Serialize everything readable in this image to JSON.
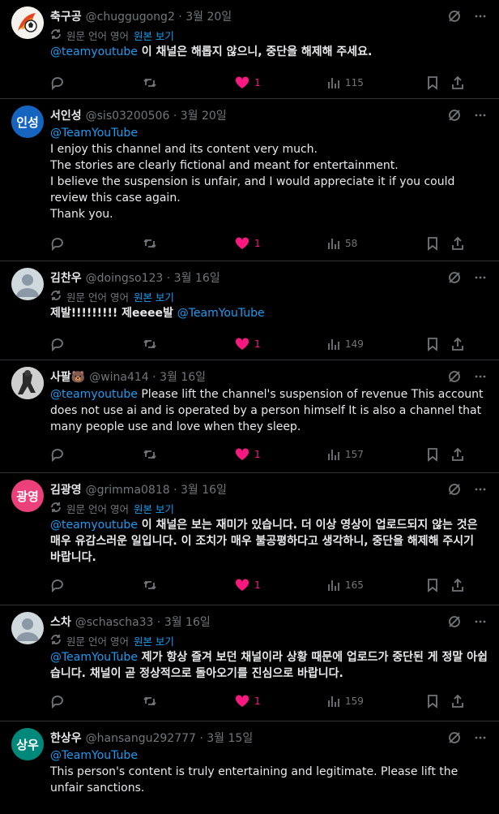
{
  "colors": {
    "accent": "#1d9bf0",
    "like": "#f91880",
    "muted": "#71767b"
  },
  "translate_label": "원문 언어 영어",
  "translate_link": "원본 보기",
  "tweets": [
    {
      "name": "축구공",
      "meta": "@chuggugong2 · 3월 20일",
      "mention": "@teamyoutube",
      "text": " 이 채널은 해롭지 않으니, 중단을 해제해 주세요.",
      "likes": "1",
      "views": "115"
    },
    {
      "name": "서인성",
      "meta": "@sis03200506 · 3월 20일",
      "avatar_text": "인성",
      "mention": "@TeamYouTube",
      "text": "I enjoy this channel and its content very much.\nThe stories are clearly fictional and meant for entertainment.\nI believe the suspension is unfair, and I would appreciate it if you could review this case again.\nThank you.",
      "likes": "1",
      "views": "58"
    },
    {
      "name": "김찬우",
      "meta": "@doingso123 · 3월 16일",
      "text": "제발!!!!!!!!! 제eeee발 ",
      "mention": "@TeamYouTube",
      "likes": "1",
      "views": "149"
    },
    {
      "name": "사팔🐻",
      "meta": "@wina414 · 3월 16일",
      "mention": "@teamyoutube",
      "text": " Please lift the channel's suspension of revenue This account does not use ai and is operated by a person himself It is also a channel that many people use and love when they sleep.",
      "likes": "1",
      "views": "157"
    },
    {
      "name": "김광영",
      "meta": "@grimma0818 · 3월 16일",
      "avatar_text": "광영",
      "mention": "@teamyoutube",
      "text": " 이 채널은 보는 재미가 있습니다. 더 이상 영상이 업로드되지 않는 것은 매우 유감스러운 일입니다. 이 조치가 매우 불공평하다고 생각하니, 중단을 해제해 주시기 바랍니다.",
      "likes": "1",
      "views": "165"
    },
    {
      "name": "스차",
      "meta": "@schascha33 · 3월 16일",
      "mention": "@TeamYouTube",
      "text": " 제가 항상 즐겨 보던 채널이라 상황 때문에 업로드가 중단된 게 정말 아쉽습니다. 채널이 곧 정상적으로 돌아오기를 진심으로 바랍니다.",
      "likes": "1",
      "views": "159"
    },
    {
      "name": "한상우",
      "meta": "@hansangu292777 · 3월 15일",
      "avatar_text": "상우",
      "mention": "@TeamYouTube",
      "text": "This person's content is truly entertaining and legitimate. Please lift the unfair sanctions."
    }
  ]
}
